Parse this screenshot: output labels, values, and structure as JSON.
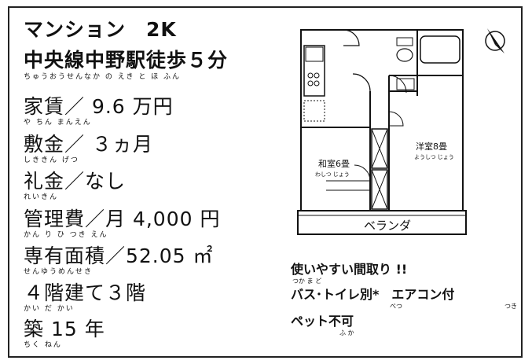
{
  "header": {
    "type_label": "マンション　2K",
    "station_line": "中央線中野駅徒歩５分",
    "station_ruby": "ちゅうおうせんなか の えき と ほ ふん"
  },
  "details": {
    "rent": {
      "text": "家賃／ 9.6 万円",
      "ruby": "や ちん まんえん"
    },
    "deposit": {
      "text": "敷金／ ３ヵ月",
      "ruby": "しききん げつ"
    },
    "key_money": {
      "text": "礼金／なし",
      "ruby": "れいきん"
    },
    "mgmt_fee": {
      "text": "管理費／月 4,000 円",
      "ruby": "かん り ひ つき えん"
    },
    "area": {
      "text": "専有面積／52.05 ㎡",
      "ruby": "せんゆうめんせき"
    },
    "floors": {
      "text": "４階建て３階",
      "ruby": "かい だ かい"
    },
    "age": {
      "text": "築 15 年",
      "ruby": "ちく ねん"
    }
  },
  "floorplan": {
    "western_room": "洋室8畳",
    "western_ruby": "ようしつ じょう",
    "japanese_room": "和室6畳",
    "japanese_ruby": "わしつ じょう",
    "veranda": "ベランダ"
  },
  "features": {
    "line1": "使いやすい間取り !!",
    "line1_ruby": "つか ま ど",
    "line2": "バス･トイレ別*　エアコン付",
    "line2_ruby_a": "べつ",
    "line2_ruby_b": "つき",
    "line3": "ペット不可",
    "line3_ruby": "ふ か"
  }
}
